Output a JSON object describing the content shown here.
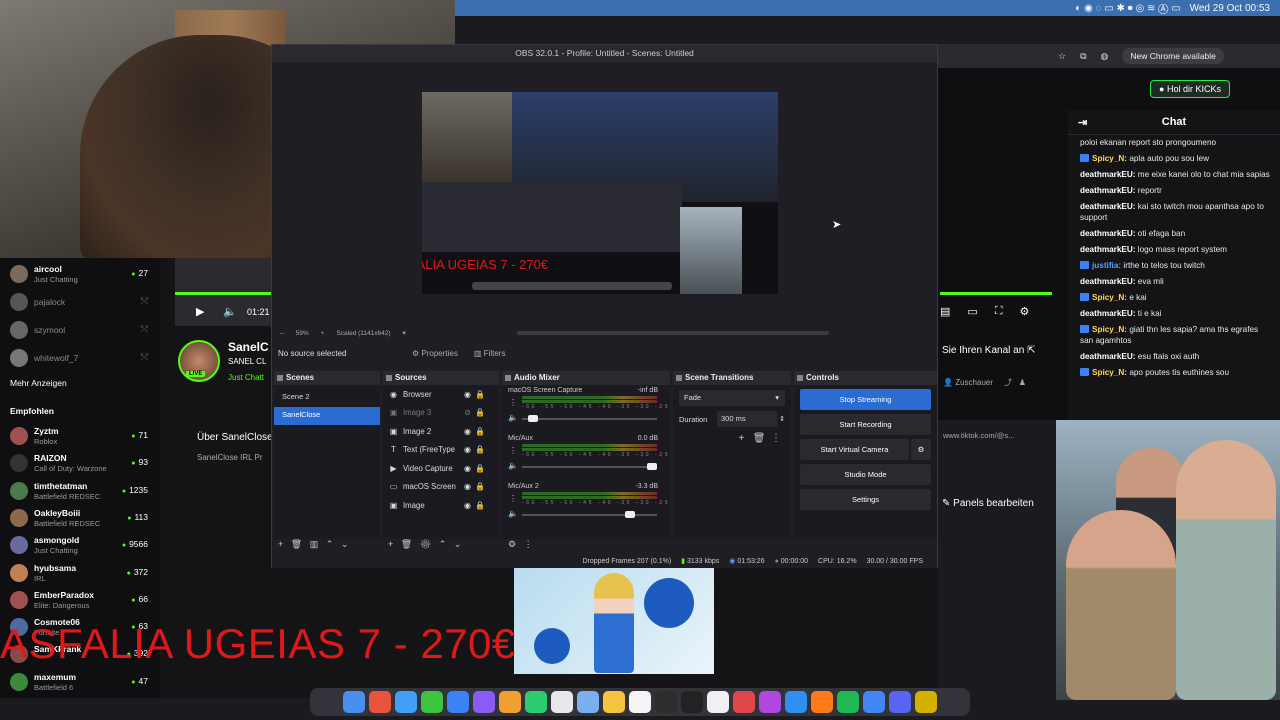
{
  "menubar": {
    "datetime": "Wed 29 Oct  00:53"
  },
  "browser": {
    "chrome_update": "New Chrome available",
    "kicks_button": "Hol dir KICKs"
  },
  "chat": {
    "title": "Chat",
    "messages": [
      {
        "user": "",
        "text": "poloi ekanan report sto prongoumeno",
        "color": "u-white",
        "badge": false
      },
      {
        "user": "Spicy_N:",
        "text": "apla auto pou sou lew",
        "color": "u-yellow",
        "badge": true
      },
      {
        "user": "deathmarkEU:",
        "text": "me eixe kanei olo to chat mia sapias",
        "color": "u-white",
        "badge": false
      },
      {
        "user": "deathmarkEU:",
        "text": "reportr",
        "color": "u-white",
        "badge": false
      },
      {
        "user": "deathmarkEU:",
        "text": "kai sto twitch mou apanthsa apo to support",
        "color": "u-white",
        "badge": false
      },
      {
        "user": "deathmarkEU:",
        "text": "oti efaga ban",
        "color": "u-white",
        "badge": false
      },
      {
        "user": "deathmarkEU:",
        "text": "logo mass report system",
        "color": "u-white",
        "badge": false
      },
      {
        "user": "justifia:",
        "text": "irthe to telos tou twitch",
        "color": "u-blue",
        "badge": true
      },
      {
        "user": "deathmarkEU:",
        "text": "eva mli",
        "color": "u-white",
        "badge": false
      },
      {
        "user": "Spicy_N:",
        "text": "e kai",
        "color": "u-yellow",
        "badge": true
      },
      {
        "user": "deathmarkEU:",
        "text": "ti e kai",
        "color": "u-white",
        "badge": false
      },
      {
        "user": "Spicy_N:",
        "text": "giati thn les sapia? ama ths egrafes san agamhtos",
        "color": "u-yellow",
        "badge": true
      },
      {
        "user": "deathmarkEU:",
        "text": "esu ftais oxi auth",
        "color": "u-white",
        "badge": false
      },
      {
        "user": "Spicy_N:",
        "text": "apo poutes tis euthines sou",
        "color": "u-yellow",
        "badge": true
      }
    ]
  },
  "sidebar": {
    "channels": [
      {
        "name": "aircool",
        "sub": "Just Chatting",
        "count": "27",
        "online": true
      },
      {
        "name": "pajalock",
        "sub": "",
        "count": "",
        "online": false
      },
      {
        "name": "szymool",
        "sub": "",
        "count": "",
        "online": false
      },
      {
        "name": "whitewolf_7",
        "sub": "",
        "count": "",
        "online": false
      }
    ],
    "show_more": "Mehr Anzeigen",
    "recommended_label": "Empfohlen",
    "recommended": [
      {
        "name": "Zyztm",
        "sub": "Roblox",
        "count": "71"
      },
      {
        "name": "RAIZON",
        "sub": "Call of Duty: Warzone",
        "count": "93"
      },
      {
        "name": "timthetatman",
        "sub": "Battlefield REDSEC",
        "count": "1235"
      },
      {
        "name": "OakleyBoiii",
        "sub": "Battlefield REDSEC",
        "count": "113"
      },
      {
        "name": "asmongold",
        "sub": "Just Chatting",
        "count": "9566"
      },
      {
        "name": "hyubsama",
        "sub": "IRL",
        "count": "372"
      },
      {
        "name": "EmberParadox",
        "sub": "Elite: Dangerous",
        "count": "66"
      },
      {
        "name": "Cosmote06",
        "sub": "Fortnite",
        "count": "63"
      },
      {
        "name": "SamKFrank",
        "sub": "",
        "count": "392"
      },
      {
        "name": "maxemum",
        "sub": "Battlefield 6",
        "count": "47"
      }
    ]
  },
  "page": {
    "player_time": "01:21",
    "streamer_name": "SanelC",
    "streamer_sub": "SANEL CL",
    "streamer_cat": "Just Chatt",
    "live_tag": "LIVE",
    "visit_channel": "Sie Ihren Kanal an",
    "viewers_label": "Zuschauer",
    "about_title": "Über SanelClose",
    "about_sub": "SanelClose IRL Pr",
    "tiktok": "www.tiktok.com/@s...",
    "panels_button": "Panels bearbeiten",
    "overlay_text": "ASFALIA UGEIAS  7 - 270€"
  },
  "obs": {
    "title": "OBS 32.0.1 - Profile: Untitled - Scenes: Untitled",
    "preview_overlay": "ASFALIA UGEIAS  7 - 270€",
    "zoom": "59%",
    "scaled": "Scaled (1141x642)",
    "no_source": "No source selected",
    "properties": "Properties",
    "filters": "Filters",
    "scenes_header": "Scenes",
    "scenes": [
      "Scene 2",
      "SanelClose"
    ],
    "sources_header": "Sources",
    "sources": [
      {
        "name": "Browser",
        "icon": "globe-icon",
        "glyph": "◉",
        "dim": false
      },
      {
        "name": "Image 3",
        "icon": "image-icon",
        "glyph": "▣",
        "dim": true
      },
      {
        "name": "Image 2",
        "icon": "image-icon",
        "glyph": "▣",
        "dim": false
      },
      {
        "name": "Text (FreeType",
        "icon": "text-icon",
        "glyph": "T",
        "dim": false
      },
      {
        "name": "Video Capture",
        "icon": "camera-icon",
        "glyph": "▶",
        "dim": false
      },
      {
        "name": "macOS Screen",
        "icon": "monitor-icon",
        "glyph": "▭",
        "dim": false
      },
      {
        "name": "Image",
        "icon": "image-icon",
        "glyph": "▣",
        "dim": false
      }
    ],
    "mixer_header": "Audio Mixer",
    "mixer": [
      {
        "name": "macOS Screen Capture",
        "db": "-inf dB",
        "level": 0.05
      },
      {
        "name": "Mic/Aux",
        "db": "0.0 dB",
        "level": 1.0
      },
      {
        "name": "Mic/Aux 2",
        "db": "-3.3 dB",
        "level": 0.82
      }
    ],
    "mixer_scale": "-60 -55 -50 -45 -40 -35 -30 -25 -20 -15 -10 -5 0",
    "transitions_header": "Scene Transitions",
    "transition": "Fade",
    "duration_label": "Duration",
    "duration": "300 ms",
    "controls_header": "Controls",
    "controls": {
      "stop_streaming": "Stop Streaming",
      "start_recording": "Start Recording",
      "virtual_camera": "Start Virtual Camera",
      "studio_mode": "Studio Mode",
      "settings": "Settings"
    },
    "status": {
      "dropped": "Dropped Frames 207 (0.1%)",
      "bitrate": "3133 kbps",
      "stream_time": "01:53:26",
      "rec_time": "00:00:00",
      "cpu": "CPU: 16.2%",
      "fps": "30.00 / 30.00 FPS"
    }
  },
  "colors": {
    "kick_green": "#53fc18",
    "obs_blue": "#2b6cd3",
    "overlay_red": "#e01818"
  }
}
